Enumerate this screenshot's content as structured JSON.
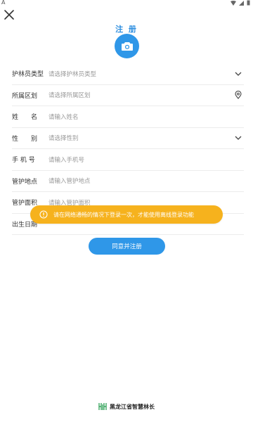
{
  "status_bar": {
    "left": "A"
  },
  "header": {
    "title": "注 册"
  },
  "form": {
    "fields": [
      {
        "label": "护林员类型",
        "placeholder": "请选择护林员类型",
        "trail": "chevron-down-icon"
      },
      {
        "label": "所属区划",
        "placeholder": "请选择所属区划",
        "trail": "location-pin-icon"
      },
      {
        "label": "姓　　名",
        "placeholder": "请输入姓名",
        "trail": ""
      },
      {
        "label": "性　　别",
        "placeholder": "请选择性别",
        "trail": "chevron-down-icon"
      },
      {
        "label": "手 机 号",
        "placeholder": "请输入手机号",
        "trail": ""
      },
      {
        "label": "管护地点",
        "placeholder": "请输入管护地点",
        "trail": ""
      },
      {
        "label": "管护面积",
        "placeholder": "请输入管护面积",
        "trail": ""
      },
      {
        "label": "出生日期",
        "placeholder": "",
        "trail": ""
      }
    ]
  },
  "toast": {
    "text": "请在网络通畅的情况下登录一次，才能使用离线登录功能"
  },
  "submit_label": "同意并注册",
  "footer": {
    "text": "黑龙江省智慧林长"
  },
  "colors": {
    "accent": "#2f97e8",
    "toast": "#f6b21d"
  }
}
